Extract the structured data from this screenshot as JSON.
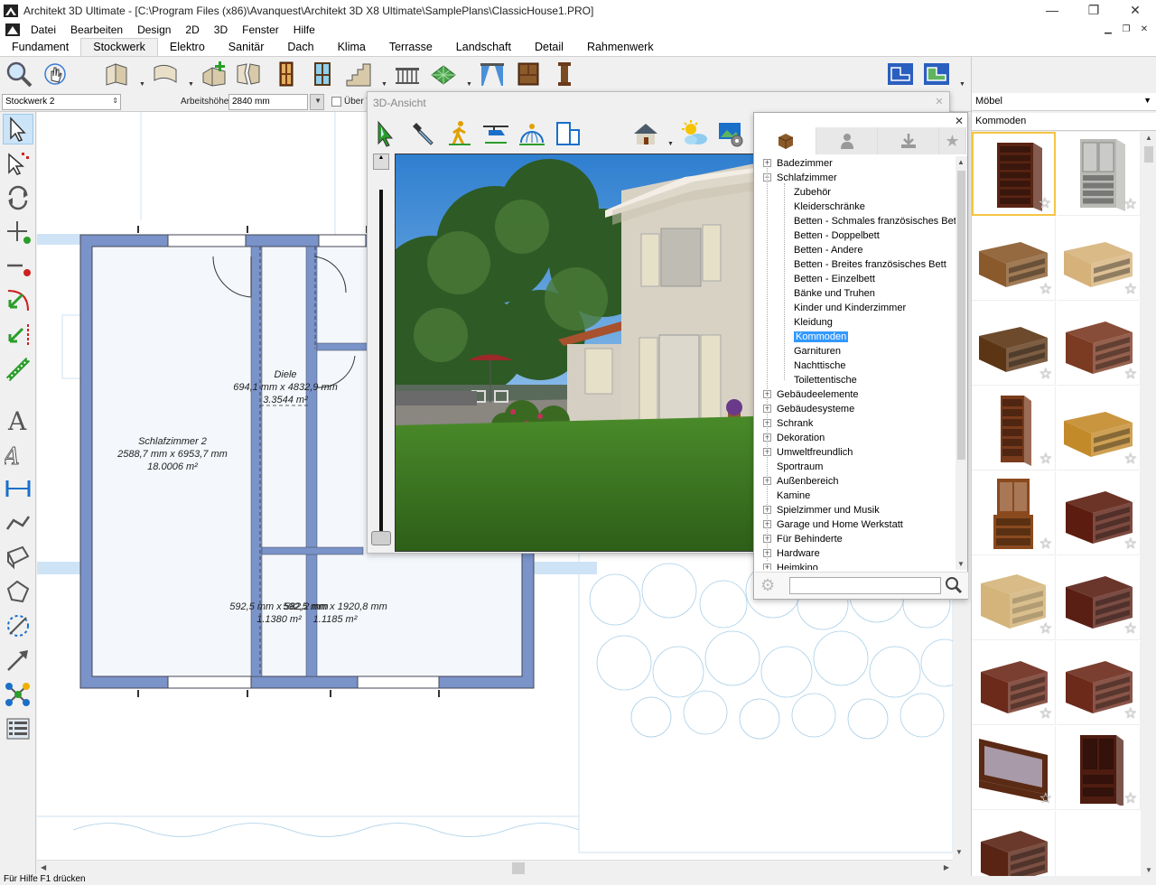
{
  "window": {
    "title": "Architekt 3D Ultimate - [C:\\Program Files (x86)\\Avanquest\\Architekt 3D X8 Ultimate\\SamplePlans\\ClassicHouse1.PRO]",
    "minimize": "—",
    "maximize": "❐",
    "close": "✕"
  },
  "menu": [
    "Datei",
    "Bearbeiten",
    "Design",
    "2D",
    "3D",
    "Fenster",
    "Hilfe"
  ],
  "tabs": [
    "Fundament",
    "Stockwerk",
    "Elektro",
    "Sanitär",
    "Dach",
    "Klima",
    "Terrasse",
    "Landschaft",
    "Detail",
    "Rahmenwerk"
  ],
  "active_tab": "Stockwerk",
  "optionbar": {
    "floor_select": "Stockwerk 2",
    "height_label": "Arbeitshöhe:",
    "height_value": "2840 mm",
    "over_label": "Über T"
  },
  "view3d": {
    "title": "3D-Ansicht"
  },
  "catalog": {
    "close": "✕",
    "search_placeholder": "",
    "tree": [
      {
        "label": "Badezimmer",
        "level": 0,
        "expander": "+"
      },
      {
        "label": "Schlafzimmer",
        "level": 0,
        "expander": "−"
      },
      {
        "label": "Zubehör",
        "level": 1
      },
      {
        "label": "Kleiderschränke",
        "level": 1
      },
      {
        "label": "Betten - Schmales französisches Bett",
        "level": 1
      },
      {
        "label": "Betten - Doppelbett",
        "level": 1
      },
      {
        "label": "Betten - Andere",
        "level": 1
      },
      {
        "label": "Betten - Breites französisches Bett",
        "level": 1
      },
      {
        "label": "Betten - Einzelbett",
        "level": 1
      },
      {
        "label": "Bänke und Truhen",
        "level": 1
      },
      {
        "label": "Kinder und Kinderzimmer",
        "level": 1
      },
      {
        "label": "Kleidung",
        "level": 1
      },
      {
        "label": "Kommoden",
        "level": 1,
        "selected": true
      },
      {
        "label": "Garnituren",
        "level": 1
      },
      {
        "label": "Nachttische",
        "level": 1
      },
      {
        "label": "Toilettentische",
        "level": 1
      },
      {
        "label": "Gebäudeelemente",
        "level": 0,
        "expander": "+"
      },
      {
        "label": "Gebäudesysteme",
        "level": 0,
        "expander": "+"
      },
      {
        "label": "Schrank",
        "level": 0,
        "expander": "+"
      },
      {
        "label": "Dekoration",
        "level": 0,
        "expander": "+"
      },
      {
        "label": "Umweltfreundlich",
        "level": 0,
        "expander": "+"
      },
      {
        "label": "Sportraum",
        "level": 0
      },
      {
        "label": "Außenbereich",
        "level": 0,
        "expander": "+"
      },
      {
        "label": "Kamine",
        "level": 0
      },
      {
        "label": "Spielzimmer und Musik",
        "level": 0,
        "expander": "+"
      },
      {
        "label": "Garage und Home Werkstatt",
        "level": 0,
        "expander": "+"
      },
      {
        "label": "Für Behinderte",
        "level": 0,
        "expander": "+"
      },
      {
        "label": "Hardware",
        "level": 0,
        "expander": "+"
      },
      {
        "label": "Heimkino",
        "level": 0,
        "expander": "+"
      }
    ]
  },
  "rightpanel": {
    "category": "Möbel",
    "subcategory": "Kommoden",
    "items": [
      {
        "icon": "tall-dresser-dark-icon",
        "color": "#5a2414",
        "shape": "tall",
        "selected": true
      },
      {
        "icon": "gray-armoire-dresser-icon",
        "color": "#b9b9b6",
        "shape": "armoire"
      },
      {
        "icon": "long-dresser-oak-icon",
        "color": "#8a5a2c",
        "shape": "long"
      },
      {
        "icon": "long-dresser-light-icon",
        "color": "#d6b27a",
        "shape": "long"
      },
      {
        "icon": "low-dresser-walnut-icon",
        "color": "#5c3614",
        "shape": "long"
      },
      {
        "icon": "wide-drawer-chest-icon",
        "color": "#7b3a22",
        "shape": "wide"
      },
      {
        "icon": "narrow-tallboy-icon",
        "color": "#7a3b1c",
        "shape": "narrow"
      },
      {
        "icon": "golden-dresser-icon",
        "color": "#c38a2a",
        "shape": "long"
      },
      {
        "icon": "hutch-cabinet-icon",
        "color": "#8a4a1e",
        "shape": "hutch"
      },
      {
        "icon": "mahogany-chest-icon",
        "color": "#5c1d10",
        "shape": "wide"
      },
      {
        "icon": "pine-chest-icon",
        "color": "#d4b47a",
        "shape": "chest"
      },
      {
        "icon": "dark-chest-icon",
        "color": "#5a1f14",
        "shape": "wide"
      },
      {
        "icon": "triple-dresser-icon",
        "color": "#6b2a1a",
        "shape": "wide"
      },
      {
        "icon": "double-dresser-icon",
        "color": "#6b2a1a",
        "shape": "wide"
      },
      {
        "icon": "dresser-mirror-icon",
        "color": "#5a2a14",
        "shape": "mirror"
      },
      {
        "icon": "tall-cabinet-icon",
        "color": "#4e1c10",
        "shape": "cabinet"
      },
      {
        "icon": "low-chest-icon",
        "color": "#5a2414",
        "shape": "wide"
      }
    ]
  },
  "plan": {
    "rooms": [
      {
        "name": "Schlafzimmer 2",
        "size": "2588,7 mm x 6953,7 mm",
        "area": "18.0006 m²"
      },
      {
        "name": "Diele",
        "size": "694,1 mm x 4832,9 mm",
        "area": "3.3544 m²"
      },
      {
        "name": "",
        "size": "592,5 mm x 582,2 mm",
        "area": "1.1380 m²"
      },
      {
        "name": "",
        "size": "592,5 mm x 1920,8 mm",
        "area": "1.1185 m²"
      }
    ]
  },
  "status": "Für Hilfe F1 drücken"
}
